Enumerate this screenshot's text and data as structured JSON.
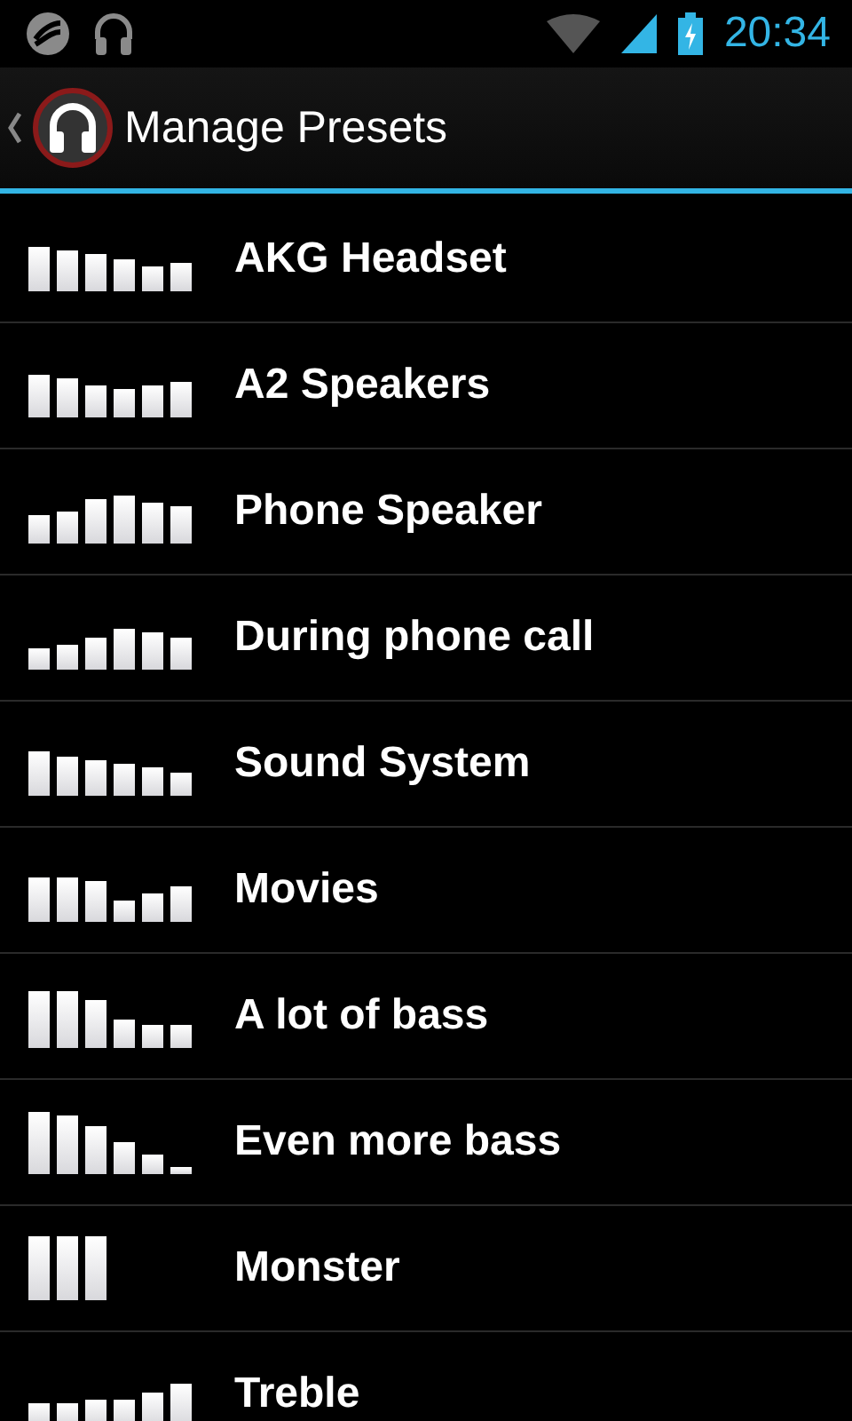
{
  "status_bar": {
    "time": "20:34"
  },
  "action_bar": {
    "title": "Manage Presets"
  },
  "presets": [
    {
      "name": "AKG Headset"
    },
    {
      "name": "A2 Speakers"
    },
    {
      "name": "Phone Speaker"
    },
    {
      "name": "During phone call"
    },
    {
      "name": "Sound System"
    },
    {
      "name": "Movies"
    },
    {
      "name": "A lot of bass"
    },
    {
      "name": "Even more bass"
    },
    {
      "name": "Monster"
    },
    {
      "name": "Treble"
    }
  ]
}
